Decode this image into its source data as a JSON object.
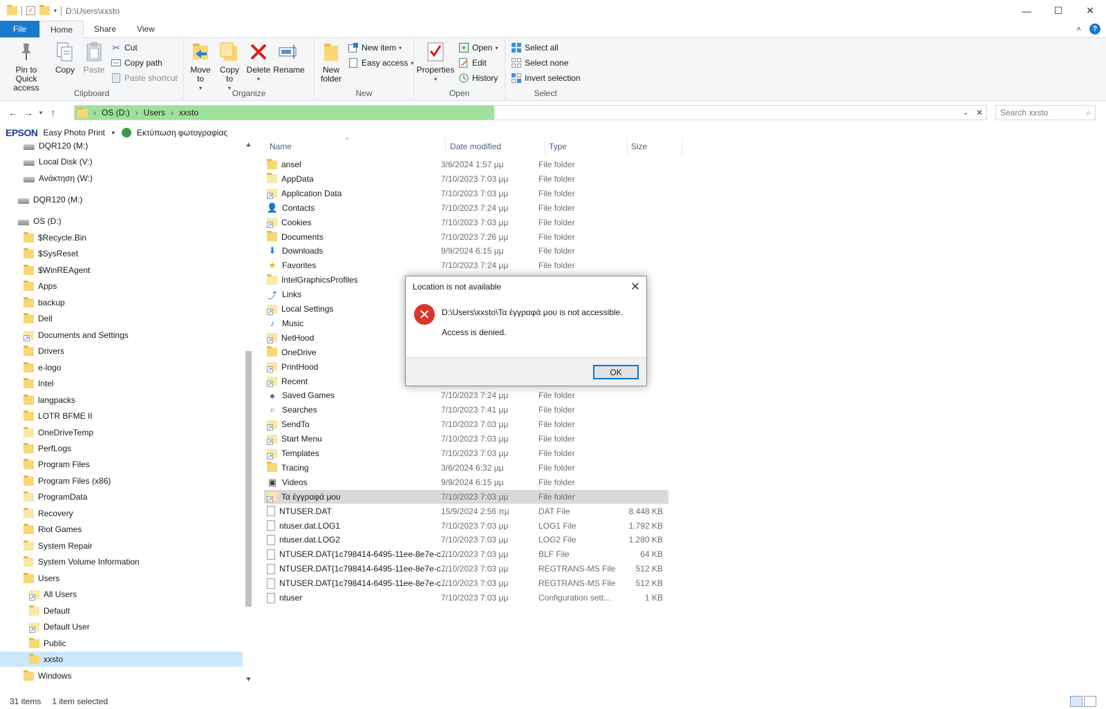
{
  "titlebar": {
    "path": "D:\\Users\\xxsto",
    "minimize": "—",
    "maximize": "☐",
    "close": "✕"
  },
  "tabs": {
    "file": "File",
    "home": "Home",
    "share": "Share",
    "view": "View",
    "collapse": "˄",
    "help": "?"
  },
  "ribbon": {
    "clipboard": {
      "label": "Clipboard",
      "pin": "Pin to Quick access",
      "copy": "Copy",
      "paste": "Paste",
      "cut": "Cut",
      "copy_path": "Copy path",
      "paste_shortcut": "Paste shortcut"
    },
    "organize": {
      "label": "Organize",
      "move_to": "Move to",
      "copy_to": "Copy to",
      "delete": "Delete",
      "rename": "Rename"
    },
    "new": {
      "label": "New",
      "new_folder": "New folder",
      "new_item": "New item",
      "easy_access": "Easy access"
    },
    "open": {
      "label": "Open",
      "properties": "Properties",
      "open": "Open",
      "edit": "Edit",
      "history": "History"
    },
    "select": {
      "label": "Select",
      "select_all": "Select all",
      "select_none": "Select none",
      "invert": "Invert selection"
    }
  },
  "address": {
    "crumbs": [
      "OS (D:)",
      "Users",
      "xxsto"
    ],
    "search_placeholder": "Search xxsto",
    "progress_pct": 46
  },
  "epson": {
    "brand": "EPSON",
    "app": "Easy Photo Print",
    "print_label": "Εκτύπωση φωτογραφίας"
  },
  "nav": [
    "DQR120 (M:)",
    "Local Disk (V:)",
    "Ανάκτηση (W:)",
    "DQR120 (M:)",
    "OS (D:)",
    "$Recycle.Bin",
    "$SysReset",
    "$WinREAgent",
    "Apps",
    "backup",
    "Dell",
    "Documents and Settings",
    "Drivers",
    "e-logo",
    "Intel",
    "langpacks",
    "LOTR BFME II",
    "OneDriveTemp",
    "PerfLogs",
    "Program Files",
    "Program Files (x86)",
    "ProgramData",
    "Recovery",
    "Riot Games",
    "System Repair",
    "System Volume Information",
    "Users",
    "All Users",
    "Default",
    "Default User",
    "Public",
    "xxsto",
    "Windows"
  ],
  "columns": {
    "name": "Name",
    "date": "Date modified",
    "type": "Type",
    "size": "Size"
  },
  "files": [
    {
      "name": "ansel",
      "date": "3/6/2024 1:57 μμ",
      "type": "File folder",
      "size": ""
    },
    {
      "name": "AppData",
      "date": "7/10/2023 7:03 μμ",
      "type": "File folder",
      "size": ""
    },
    {
      "name": "Application Data",
      "date": "7/10/2023 7:03 μμ",
      "type": "File folder",
      "size": ""
    },
    {
      "name": "Contacts",
      "date": "7/10/2023 7:24 μμ",
      "type": "File folder",
      "size": ""
    },
    {
      "name": "Cookies",
      "date": "7/10/2023 7:03 μμ",
      "type": "File folder",
      "size": ""
    },
    {
      "name": "Documents",
      "date": "7/10/2023 7:26 μμ",
      "type": "File folder",
      "size": ""
    },
    {
      "name": "Downloads",
      "date": "9/9/2024 6:15 μμ",
      "type": "File folder",
      "size": ""
    },
    {
      "name": "Favorites",
      "date": "7/10/2023 7:24 μμ",
      "type": "File folder",
      "size": ""
    },
    {
      "name": "IntelGraphicsProfiles",
      "date": "",
      "type": "",
      "size": ""
    },
    {
      "name": "Links",
      "date": "",
      "type": "",
      "size": ""
    },
    {
      "name": "Local Settings",
      "date": "",
      "type": "",
      "size": ""
    },
    {
      "name": "Music",
      "date": "",
      "type": "",
      "size": ""
    },
    {
      "name": "NetHood",
      "date": "",
      "type": "",
      "size": ""
    },
    {
      "name": "OneDrive",
      "date": "",
      "type": "",
      "size": ""
    },
    {
      "name": "PrintHood",
      "date": "",
      "type": "",
      "size": ""
    },
    {
      "name": "Recent",
      "date": "",
      "type": "",
      "size": ""
    },
    {
      "name": "Saved Games",
      "date": "7/10/2023 7:24 μμ",
      "type": "File folder",
      "size": ""
    },
    {
      "name": "Searches",
      "date": "7/10/2023 7:41 μμ",
      "type": "File folder",
      "size": ""
    },
    {
      "name": "SendTo",
      "date": "7/10/2023 7:03 μμ",
      "type": "File folder",
      "size": ""
    },
    {
      "name": "Start Menu",
      "date": "7/10/2023 7:03 μμ",
      "type": "File folder",
      "size": ""
    },
    {
      "name": "Templates",
      "date": "7/10/2023 7:03 μμ",
      "type": "File folder",
      "size": ""
    },
    {
      "name": "Tracing",
      "date": "3/6/2024 6:32 μμ",
      "type": "File folder",
      "size": ""
    },
    {
      "name": "Videos",
      "date": "9/9/2024 6:15 μμ",
      "type": "File folder",
      "size": ""
    },
    {
      "name": "Τα έγγραφά μου",
      "date": "7/10/2023 7:03 μμ",
      "type": "File folder",
      "size": ""
    },
    {
      "name": "NTUSER.DAT",
      "date": "15/9/2024 2:56 πμ",
      "type": "DAT File",
      "size": "8.448 KB"
    },
    {
      "name": "ntuser.dat.LOG1",
      "date": "7/10/2023 7:03 μμ",
      "type": "LOG1 File",
      "size": "1.792 KB"
    },
    {
      "name": "ntuser.dat.LOG2",
      "date": "7/10/2023 7:03 μμ",
      "type": "LOG2 File",
      "size": "1.280 KB"
    },
    {
      "name": "NTUSER.DAT{1c798414-6495-11ee-8e7e-c...",
      "date": "7/10/2023 7:03 μμ",
      "type": "BLF File",
      "size": "64 KB"
    },
    {
      "name": "NTUSER.DAT{1c798414-6495-11ee-8e7e-c...",
      "date": "7/10/2023 7:03 μμ",
      "type": "REGTRANS-MS File",
      "size": "512 KB"
    },
    {
      "name": "NTUSER.DAT{1c798414-6495-11ee-8e7e-c...",
      "date": "7/10/2023 7:03 μμ",
      "type": "REGTRANS-MS File",
      "size": "512 KB"
    },
    {
      "name": "ntuser",
      "date": "7/10/2023 7:03 μμ",
      "type": "Configuration sett...",
      "size": "1 KB"
    }
  ],
  "status": {
    "count": "31 items",
    "selected": "1 item selected"
  },
  "dialog": {
    "title": "Location is not available",
    "message": "D:\\Users\\xxsto\\Τα έγγραφά μου is not accessible.",
    "detail": "Access is denied.",
    "ok": "OK"
  }
}
